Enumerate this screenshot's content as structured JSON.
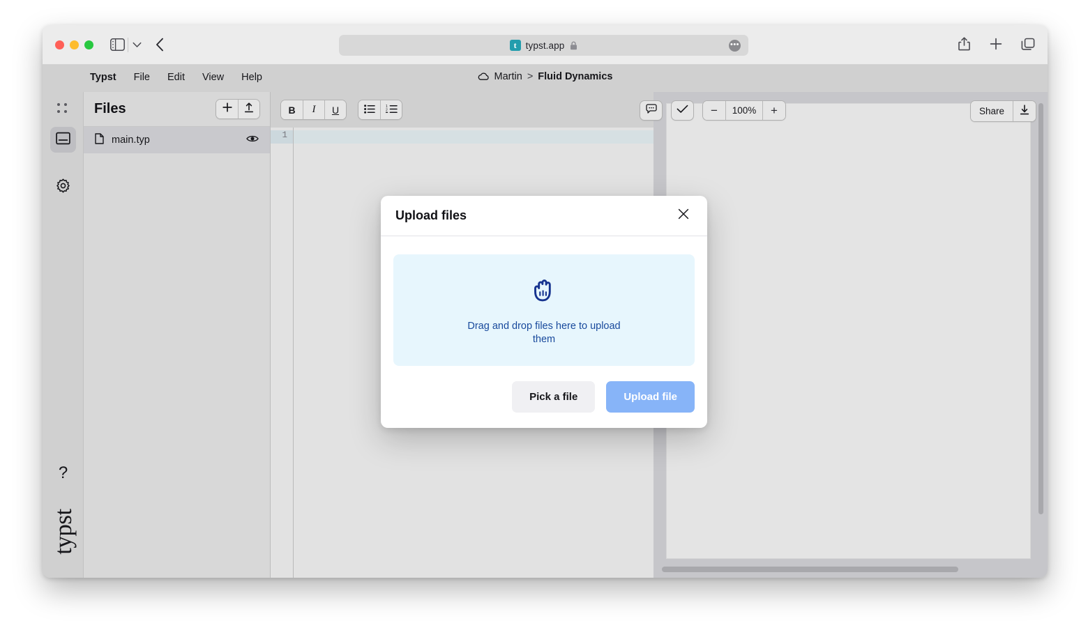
{
  "browser": {
    "traffic_lights": [
      "close",
      "minimize",
      "zoom"
    ],
    "url": "typst.app",
    "favicon_letter": "t",
    "more_glyph": "•••",
    "icons": {
      "sidebar_toggle": "sidebar-toggle-icon",
      "chevron_down": "chevron-down-icon",
      "back": "back-arrow-icon",
      "lock": "lock-icon",
      "share": "share-icon",
      "new_tab": "plus-icon",
      "tab_overview": "tab-overview-icon"
    }
  },
  "app": {
    "menu": [
      {
        "label": "Typst",
        "brand": true
      },
      {
        "label": "File",
        "brand": false
      },
      {
        "label": "Edit",
        "brand": false
      },
      {
        "label": "View",
        "brand": false
      },
      {
        "label": "Help",
        "brand": false
      }
    ],
    "breadcrumb": {
      "icon": "cloud-icon",
      "owner": "Martin",
      "separator": ">",
      "document": "Fluid Dynamics"
    }
  },
  "rail": {
    "items": [
      {
        "name": "grip",
        "icon": "grip-dots-icon",
        "active": false
      },
      {
        "name": "files",
        "icon": "files-panel-icon",
        "active": true
      },
      {
        "name": "settings",
        "icon": "gear-icon",
        "active": false
      }
    ],
    "help_glyph": "?",
    "wordmark": "typst"
  },
  "files_panel": {
    "title": "Files",
    "add_icon": "plus-icon",
    "upload_icon": "upload-arrow-icon",
    "files": [
      {
        "name": "main.typ",
        "doc_icon": "document-icon",
        "visibility_icon": "eye-icon",
        "selected": true
      }
    ]
  },
  "editor": {
    "toolbar": {
      "bold": "B",
      "italic": "I",
      "underline": "U",
      "bullet_list_icon": "bullet-list-icon",
      "numbered_list_icon": "numbered-list-icon"
    },
    "line_numbers": [
      "1"
    ],
    "content": ""
  },
  "center_tools": {
    "comment_icon": "comment-bubble-icon",
    "check_icon": "checkmark-icon",
    "zoom_out": "−",
    "zoom_level": "100%",
    "zoom_in": "+"
  },
  "share": {
    "label": "Share",
    "download_icon": "download-icon"
  },
  "modal": {
    "title": "Upload files",
    "close_icon": "close-icon",
    "dropzone": {
      "icon": "open-hand-icon",
      "text": "Drag and drop files here to upload them"
    },
    "buttons": {
      "secondary": "Pick a file",
      "primary": "Upload file"
    }
  },
  "colors": {
    "accent_blue": "#87b4f8",
    "dropzone_bg": "#e7f6fd",
    "dropzone_text": "#18499c",
    "favicon_teal": "#239dad",
    "traffic_red": "#ff5f57",
    "traffic_yellow": "#febc2e",
    "traffic_green": "#28c840"
  }
}
